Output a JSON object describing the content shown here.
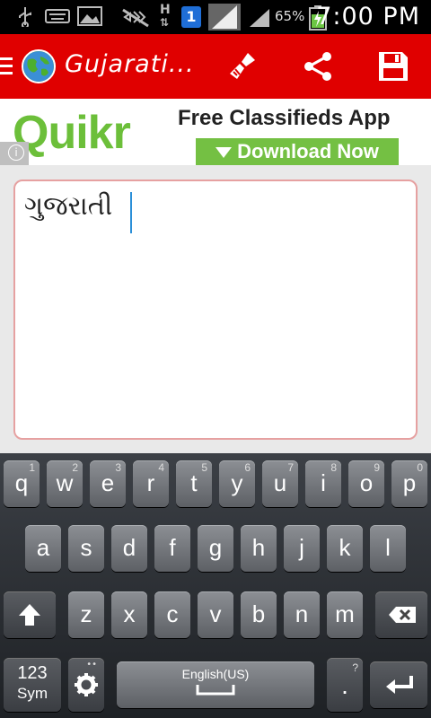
{
  "status_bar": {
    "time": "7:00 PM",
    "battery_percent": "65%",
    "icons": [
      "usb-icon",
      "keyboard-icon",
      "image-icon",
      "mute-icon",
      "hsdpa-icon",
      "sim-1-icon",
      "signal-icon",
      "signal-icon",
      "battery-charging-icon"
    ],
    "hsdpa_label": "H",
    "sim_label": "1"
  },
  "app_bar": {
    "title": "Gujarati...",
    "actions": [
      "clear-icon",
      "share-icon",
      "save-icon"
    ],
    "background_color": "#e00000"
  },
  "ad": {
    "brand": "Quikr",
    "headline": "Free Classifieds App",
    "cta": "Download Now",
    "info_glyph": "i"
  },
  "editor": {
    "text": "ગુજરાતી"
  },
  "keyboard": {
    "row1": [
      {
        "key": "q",
        "sub": "1"
      },
      {
        "key": "w",
        "sub": "2"
      },
      {
        "key": "e",
        "sub": "3"
      },
      {
        "key": "r",
        "sub": "4"
      },
      {
        "key": "t",
        "sub": "5"
      },
      {
        "key": "y",
        "sub": "6"
      },
      {
        "key": "u",
        "sub": "7"
      },
      {
        "key": "i",
        "sub": "8"
      },
      {
        "key": "o",
        "sub": "9"
      },
      {
        "key": "p",
        "sub": "0"
      }
    ],
    "row2": [
      "a",
      "s",
      "d",
      "f",
      "g",
      "h",
      "j",
      "k",
      "l"
    ],
    "row3": [
      "z",
      "x",
      "c",
      "v",
      "b",
      "n",
      "m"
    ],
    "sym_label": "123\nSym",
    "sym_line1": "123",
    "sym_line2": "Sym",
    "space_label": "English(US)",
    "period_label": ".",
    "period_sub": "?",
    "settings_icon": "gear-icon",
    "shift_icon": "shift-icon",
    "backspace_icon": "backspace-icon",
    "enter_icon": "enter-icon"
  }
}
